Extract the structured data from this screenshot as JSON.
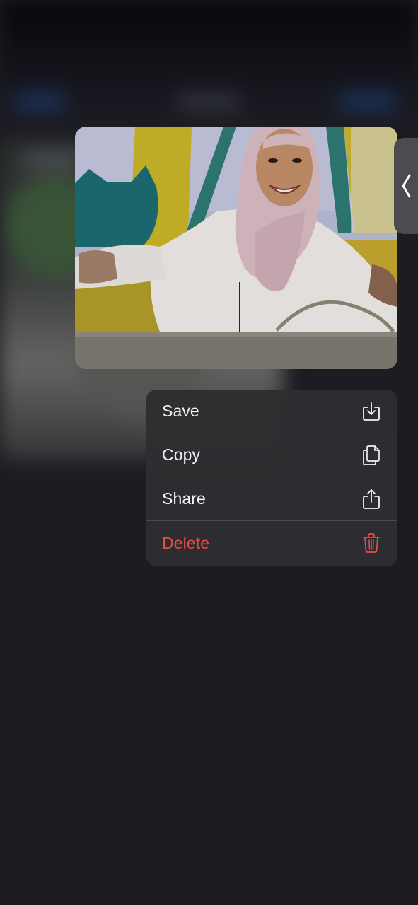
{
  "preview": {
    "image_name": "photo-preview"
  },
  "side_handle": {
    "icon": "chevron-left-icon"
  },
  "menu": {
    "items": [
      {
        "label": "Save",
        "icon": "save-download-icon",
        "destructive": false
      },
      {
        "label": "Copy",
        "icon": "copy-documents-icon",
        "destructive": false
      },
      {
        "label": "Share",
        "icon": "share-icon",
        "destructive": false
      },
      {
        "label": "Delete",
        "icon": "trash-icon",
        "destructive": true
      }
    ]
  },
  "colors": {
    "background": "#1c1c21",
    "menu_background": "#2e2e32",
    "text": "#f2f2f4",
    "destructive": "#eb4a40"
  }
}
